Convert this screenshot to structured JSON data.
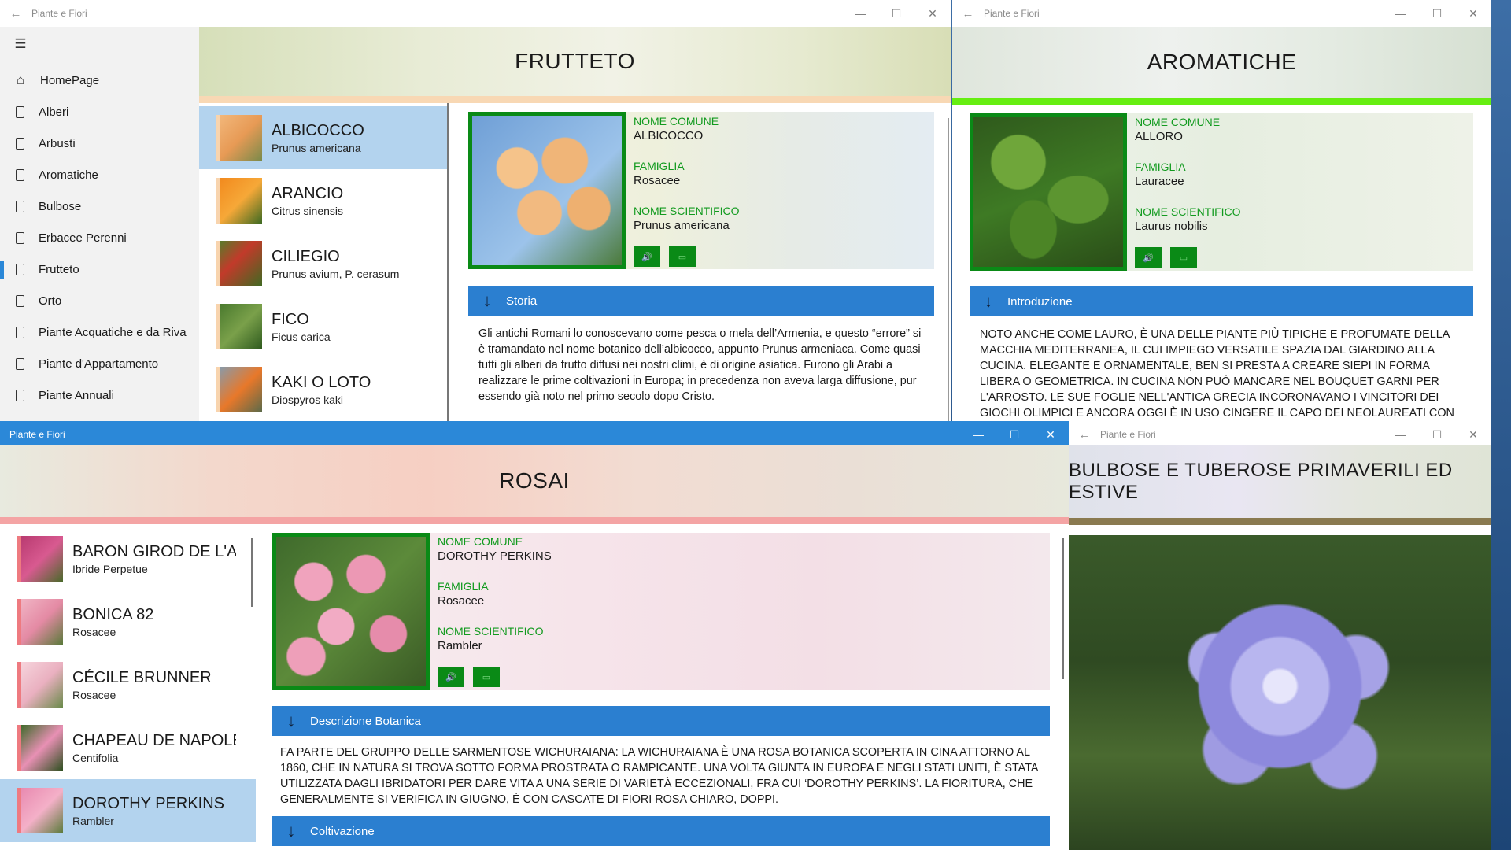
{
  "app_title": "Piante e Fiori",
  "nav": {
    "menu_icon": "hamburger-icon",
    "items": [
      {
        "label": "HomePage",
        "icon": "home-icon"
      },
      {
        "label": "Alberi",
        "icon": "page-icon"
      },
      {
        "label": "Arbusti",
        "icon": "page-icon"
      },
      {
        "label": "Aromatiche",
        "icon": "page-icon"
      },
      {
        "label": "Bulbose",
        "icon": "page-icon"
      },
      {
        "label": "Erbacee Perenni",
        "icon": "page-icon"
      },
      {
        "label": "Frutteto",
        "icon": "page-icon"
      },
      {
        "label": "Orto",
        "icon": "page-icon"
      },
      {
        "label": "Piante Acquatiche e da Riva",
        "icon": "page-icon"
      },
      {
        "label": "Piante d'Appartamento",
        "icon": "page-icon"
      },
      {
        "label": "Piante Annuali",
        "icon": "page-icon"
      }
    ],
    "selected": "Frutteto"
  },
  "frutteto": {
    "header": "FRUTTETO",
    "accent": "#f8d0a8",
    "list": [
      {
        "name": "ALBICOCCO",
        "sub": "Prunus americana"
      },
      {
        "name": "ARANCIO",
        "sub": "Citrus sinensis"
      },
      {
        "name": "CILIEGIO",
        "sub": "Prunus avium, P. cerasum"
      },
      {
        "name": "FICO",
        "sub": "Ficus carica"
      },
      {
        "name": "KAKI O LOTO",
        "sub": "Diospyros kaki"
      }
    ],
    "selected": "ALBICOCCO",
    "detail": {
      "nome_comune_label": "NOME COMUNE",
      "nome_comune": "ALBICOCCO",
      "famiglia_label": "FAMIGLIA",
      "famiglia": "Rosacee",
      "nome_scientifico_label": "NOME SCIENTIFICO",
      "nome_scientifico": "Prunus americana",
      "section": "Storia",
      "text": "Gli antichi Romani lo conoscevano come pesca o mela dell’Armenia, e questo “errore” si è tramandato nel nome botanico dell’albicocco, appunto Prunus armeniaca. Come quasi tutti gli alberi da frutto diffusi nei nostri climi, è di origine asiatica. Furono gli Arabi a realizzare le prime coltivazioni in Europa; in precedenza non aveva larga diffusione, pur essendo già noto nel primo secolo dopo Cristo."
    }
  },
  "aromatiche": {
    "header": "AROMATICHE",
    "accent": "#66ee11",
    "detail": {
      "nome_comune_label": "NOME COMUNE",
      "nome_comune": "ALLORO",
      "famiglia_label": "FAMIGLIA",
      "famiglia": "Lauracee",
      "nome_scientifico_label": "NOME SCIENTIFICO",
      "nome_scientifico": "Laurus nobilis",
      "section": "Introduzione",
      "text": "NOTO ANCHE COME LAURO, È UNA DELLE PIANTE PIÙ TIPICHE E PROFUMATE DELLA MACCHIA MEDITERRANEA, IL CUI IMPIEGO VERSATILE SPAZIA DAL GIARDINO ALLA CUCINA. ELEGANTE E ORNAMENTALE, BEN SI PRESTA A CREARE SIEPI IN FORMA LIBERA O GEOMETRICA. IN CUCINA NON PUÒ MANCARE NEL BOUQUET GARNI PER L'ARROSTO. LE SUE FOGLIE NELL'ANTICA GRECIA INCORONAVANO I VINCITORI DEI GIOCHI OLIMPICI E ANCORA OGGI È IN USO CINGERE IL CAPO DEI NEOLAUREATI CON RAMI D'ALLORO."
    }
  },
  "rosai": {
    "header": "ROSAI",
    "accent": "#f4a0a0",
    "list": [
      {
        "name": "BARON GIROD DE L'AIN",
        "sub": "Ibride Perpetue"
      },
      {
        "name": "BONICA 82",
        "sub": "Rosacee"
      },
      {
        "name": "CÉCILE BRUNNER",
        "sub": "Rosacee"
      },
      {
        "name": "CHAPEAU DE NAPOLÉON",
        "sub": "Centifolia"
      },
      {
        "name": "DOROTHY PERKINS",
        "sub": "Rambler"
      }
    ],
    "selected": "DOROTHY PERKINS",
    "detail": {
      "nome_comune_label": "NOME COMUNE",
      "nome_comune": "DOROTHY PERKINS",
      "famiglia_label": "FAMIGLIA",
      "famiglia": "Rosacee",
      "nome_scientifico_label": "NOME SCIENTIFICO",
      "nome_scientifico": "Rambler",
      "section": "Descrizione Botanica",
      "text": "FA PARTE DEL GRUPPO DELLE SARMENTOSE WICHURAIANA: LA WICHURAIANA È UNA ROSA BOTANICA SCOPERTA IN CINA ATTORNO AL 1860, CHE IN NATURA SI TROVA SOTTO FORMA PROSTRATA O RAMPICANTE. UNA VOLTA GIUNTA IN EUROPA E NEGLI STATI UNITI, È STATA UTILIZZATA DAGLI IBRIDATORI PER DARE VITA A UNA SERIE DI VARIETÀ ECCEZIONALI, FRA CUI ‘DOROTHY PERKINS’. LA FIORITURA, CHE GENERALMENTE SI VERIFICA IN GIUGNO, È CON CASCATE DI FIORI ROSA CHIARO, DOPPI.",
      "section2": "Coltivazione"
    }
  },
  "bulbose": {
    "header": "BULBOSE E TUBEROSE PRIMAVERILI ED ESTIVE",
    "accent": "#8a7a50"
  },
  "icons": {
    "back": "back-arrow-icon",
    "minimize": "minimize-icon",
    "maximize": "maximize-icon",
    "close": "close-icon",
    "audio": "speaker-icon",
    "video": "video-icon",
    "expand": "down-arrow-icon"
  }
}
